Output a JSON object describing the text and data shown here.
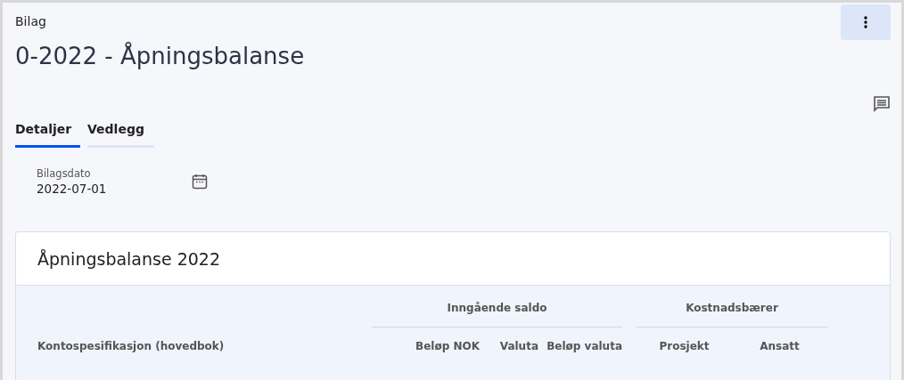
{
  "breadcrumb": "Bilag",
  "title": "0-2022 - Åpningsbalanse",
  "tabs": [
    {
      "label": "Detaljer",
      "selected": true
    },
    {
      "label": "Vedlegg",
      "selected": false
    }
  ],
  "date_field": {
    "label": "Bilagsdato",
    "value": "2022-07-01"
  },
  "card": {
    "title": "Åpningsbalanse 2022",
    "column_groups": [
      "Inngående saldo",
      "Kostnadsbærer"
    ],
    "columns": [
      "Kontospesifikasjon (hovedbok)",
      "Beløp NOK",
      "Valuta",
      "Beløp valuta",
      "Prosjekt",
      "Ansatt"
    ]
  }
}
